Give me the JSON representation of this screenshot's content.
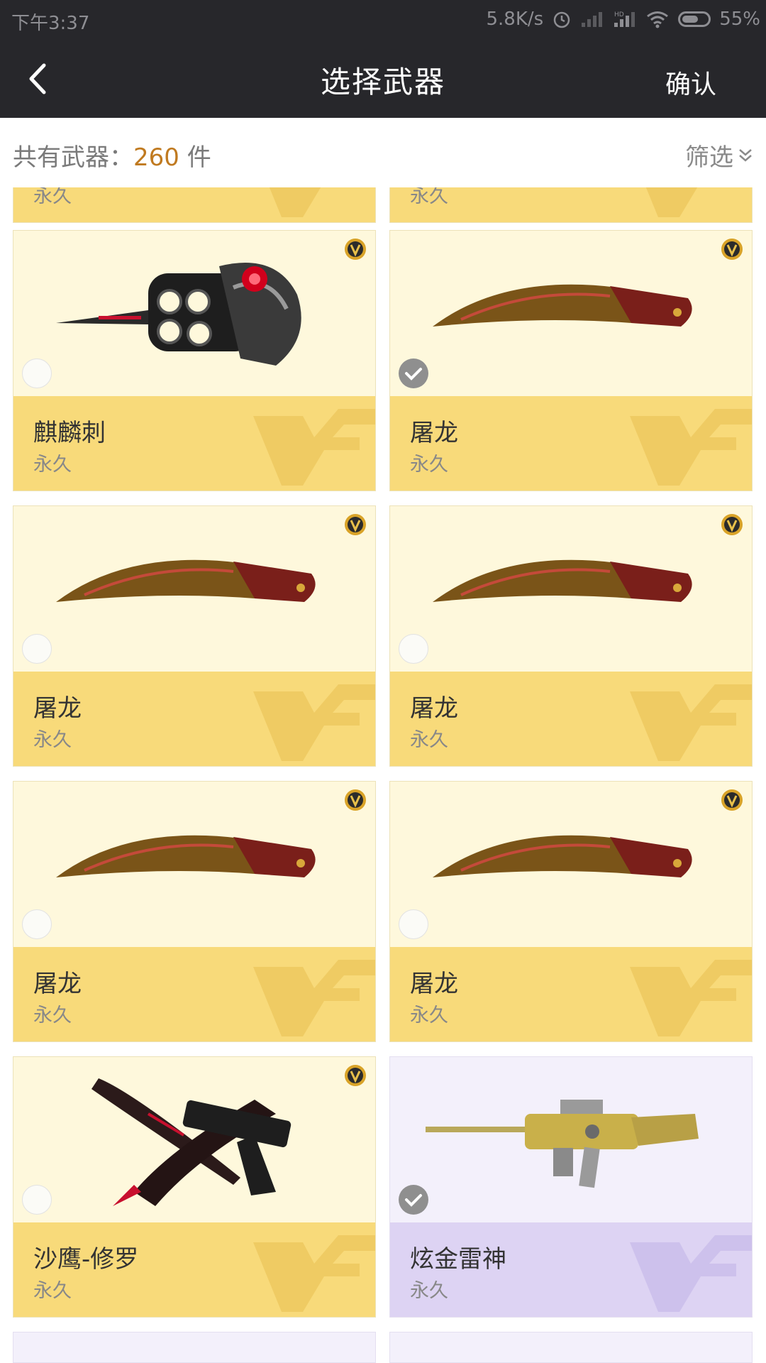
{
  "status_bar": {
    "time": "下午3:37",
    "network_speed": "5.8K/s",
    "battery": "55%",
    "icons": [
      "alarm-icon",
      "signal-icon",
      "hd-signal-icon",
      "wifi-icon",
      "battery-icon"
    ]
  },
  "nav": {
    "back_icon": "chevron-left-icon",
    "title": "选择武器",
    "confirm_label": "确认"
  },
  "summary": {
    "count_prefix": "共有武器：",
    "count_value": "260",
    "count_unit": " 件",
    "filter_label": "筛选",
    "filter_icon": "double-chevron-down-icon"
  },
  "colors": {
    "header_bg": "#27272b",
    "accent_count": "#c07a20",
    "card_gold_bg": "#fef8dc",
    "card_gold_info": "#f8da7a",
    "card_purple_bg": "#f3f0fb",
    "card_purple_info": "#ddd3f3"
  },
  "partial_top_cards": [
    {
      "duration": "永久"
    },
    {
      "duration": "永久"
    }
  ],
  "weapons": [
    {
      "name": "麒麟刺",
      "duration": "永久",
      "selected": false,
      "vip": true,
      "rarity": "gold",
      "art": "knuckle-dagger"
    },
    {
      "name": "屠龙",
      "duration": "永久",
      "selected": true,
      "vip": true,
      "rarity": "gold",
      "art": "kukri"
    },
    {
      "name": "屠龙",
      "duration": "永久",
      "selected": false,
      "vip": true,
      "rarity": "gold",
      "art": "kukri"
    },
    {
      "name": "屠龙",
      "duration": "永久",
      "selected": false,
      "vip": true,
      "rarity": "gold",
      "art": "kukri"
    },
    {
      "name": "屠龙",
      "duration": "永久",
      "selected": false,
      "vip": true,
      "rarity": "gold",
      "art": "kukri"
    },
    {
      "name": "屠龙",
      "duration": "永久",
      "selected": false,
      "vip": true,
      "rarity": "gold",
      "art": "kukri"
    },
    {
      "name": "沙鹰-修罗",
      "duration": "永久",
      "selected": false,
      "vip": true,
      "rarity": "gold",
      "art": "pistol-blade"
    },
    {
      "name": "炫金雷神",
      "duration": "永久",
      "selected": true,
      "vip": false,
      "rarity": "purple",
      "art": "rifle"
    }
  ]
}
